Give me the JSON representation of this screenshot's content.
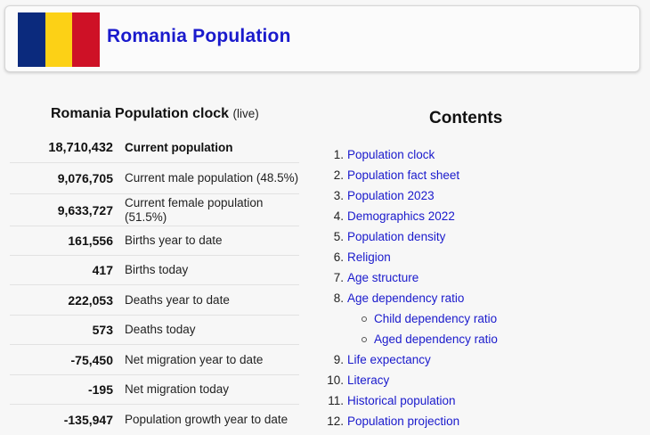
{
  "header": {
    "title": "Romania Population",
    "flag_colors": [
      "#0b2a7d",
      "#fcd116",
      "#ce1126"
    ]
  },
  "clock": {
    "title": "Romania Population clock",
    "live_label": "(live)",
    "rows": [
      {
        "value": "18,710,432",
        "label": "Current population"
      },
      {
        "value": "9,076,705",
        "label": "Current male population (48.5%)"
      },
      {
        "value": "9,633,727",
        "label": "Current female population (51.5%)"
      },
      {
        "value": "161,556",
        "label": "Births year to date"
      },
      {
        "value": "417",
        "label": "Births today"
      },
      {
        "value": "222,053",
        "label": "Deaths year to date"
      },
      {
        "value": "573",
        "label": "Deaths today"
      },
      {
        "value": "-75,450",
        "label": "Net migration year to date"
      },
      {
        "value": "-195",
        "label": "Net migration today"
      },
      {
        "value": "-135,947",
        "label": "Population growth year to date"
      }
    ]
  },
  "contents": {
    "title": "Contents",
    "items": [
      {
        "num": "1.",
        "label": "Population clock"
      },
      {
        "num": "2.",
        "label": "Population fact sheet"
      },
      {
        "num": "3.",
        "label": "Population 2023"
      },
      {
        "num": "4.",
        "label": "Demographics 2022"
      },
      {
        "num": "5.",
        "label": "Population density"
      },
      {
        "num": "6.",
        "label": "Religion"
      },
      {
        "num": "7.",
        "label": "Age structure"
      },
      {
        "num": "8.",
        "label": "Age dependency ratio"
      },
      {
        "num": "9.",
        "label": "Life expectancy"
      },
      {
        "num": "10.",
        "label": "Literacy"
      },
      {
        "num": "11.",
        "label": "Historical population"
      },
      {
        "num": "12.",
        "label": "Population projection"
      }
    ],
    "subitems": [
      {
        "label": "Child dependency ratio"
      },
      {
        "label": "Aged dependency ratio"
      }
    ]
  },
  "colors": {
    "link": "#1a1acc",
    "background": "#f7f7f7"
  }
}
